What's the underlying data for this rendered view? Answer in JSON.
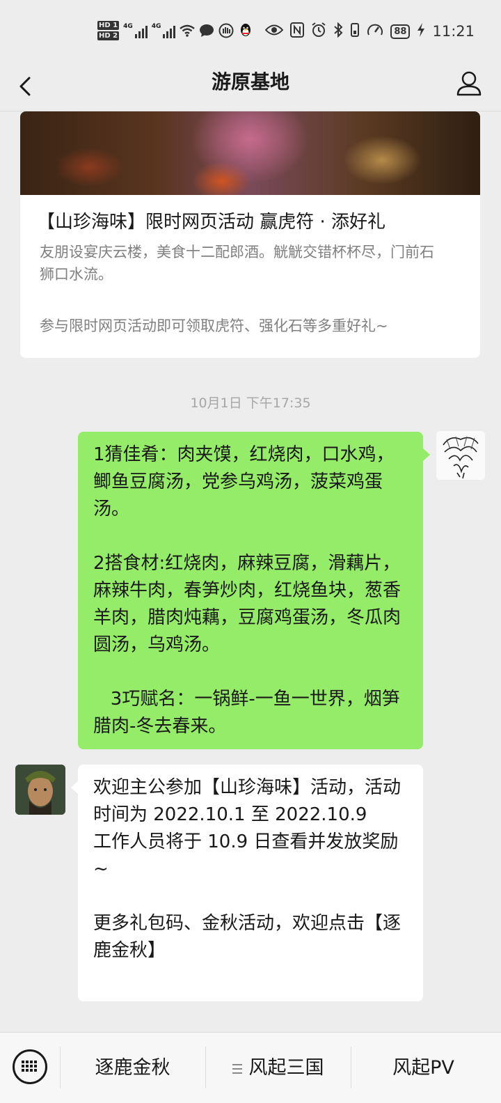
{
  "status_bar": {
    "hd1": "HD 1",
    "hd2": "HD 2",
    "net1": "4G",
    "net2": "4G",
    "battery": "88",
    "time": "11:21"
  },
  "nav": {
    "title": "游原基地"
  },
  "article": {
    "title": "【山珍海味】限时网页活动 赢虎符 · 添好礼",
    "description": "友朋设宴庆云楼，美食十二配郎酒。觥觥交错杯杯尽，门前石狮口水流。",
    "note": "参与限时网页活动即可领取虎符、强化石等多重好礼~"
  },
  "timestamp": "10月1日 下午17:35",
  "messages": {
    "sent": {
      "p1": "1猜佳肴：肉夹馍，红烧肉，口水鸡，鲫鱼豆腐汤，党参乌鸡汤，菠菜鸡蛋汤。",
      "p2": "2搭食材:红烧肉，麻辣豆腐，滑藕片，麻辣牛肉，春笋炒肉，红烧鱼块，葱香羊肉，腊肉炖藕，豆腐鸡蛋汤，冬瓜肉圆汤，乌鸡汤。",
      "p3": "   3巧赋名：一锅鲜-一鱼一世界，烟笋腊肉-冬去春来。"
    },
    "received": {
      "line1": "欢迎主公参加【山珍海味】活动，活动时间为 2022.10.1 至 2022.10.9",
      "line2": "工作人员将于 10.9 日查看并发放奖励 ~",
      "line3": "更多礼包码、金秋活动，欢迎点击【逐鹿金秋】"
    }
  },
  "bottom_menu": {
    "item1": "逐鹿金秋",
    "item2": "风起三国",
    "item3": "风起PV"
  }
}
